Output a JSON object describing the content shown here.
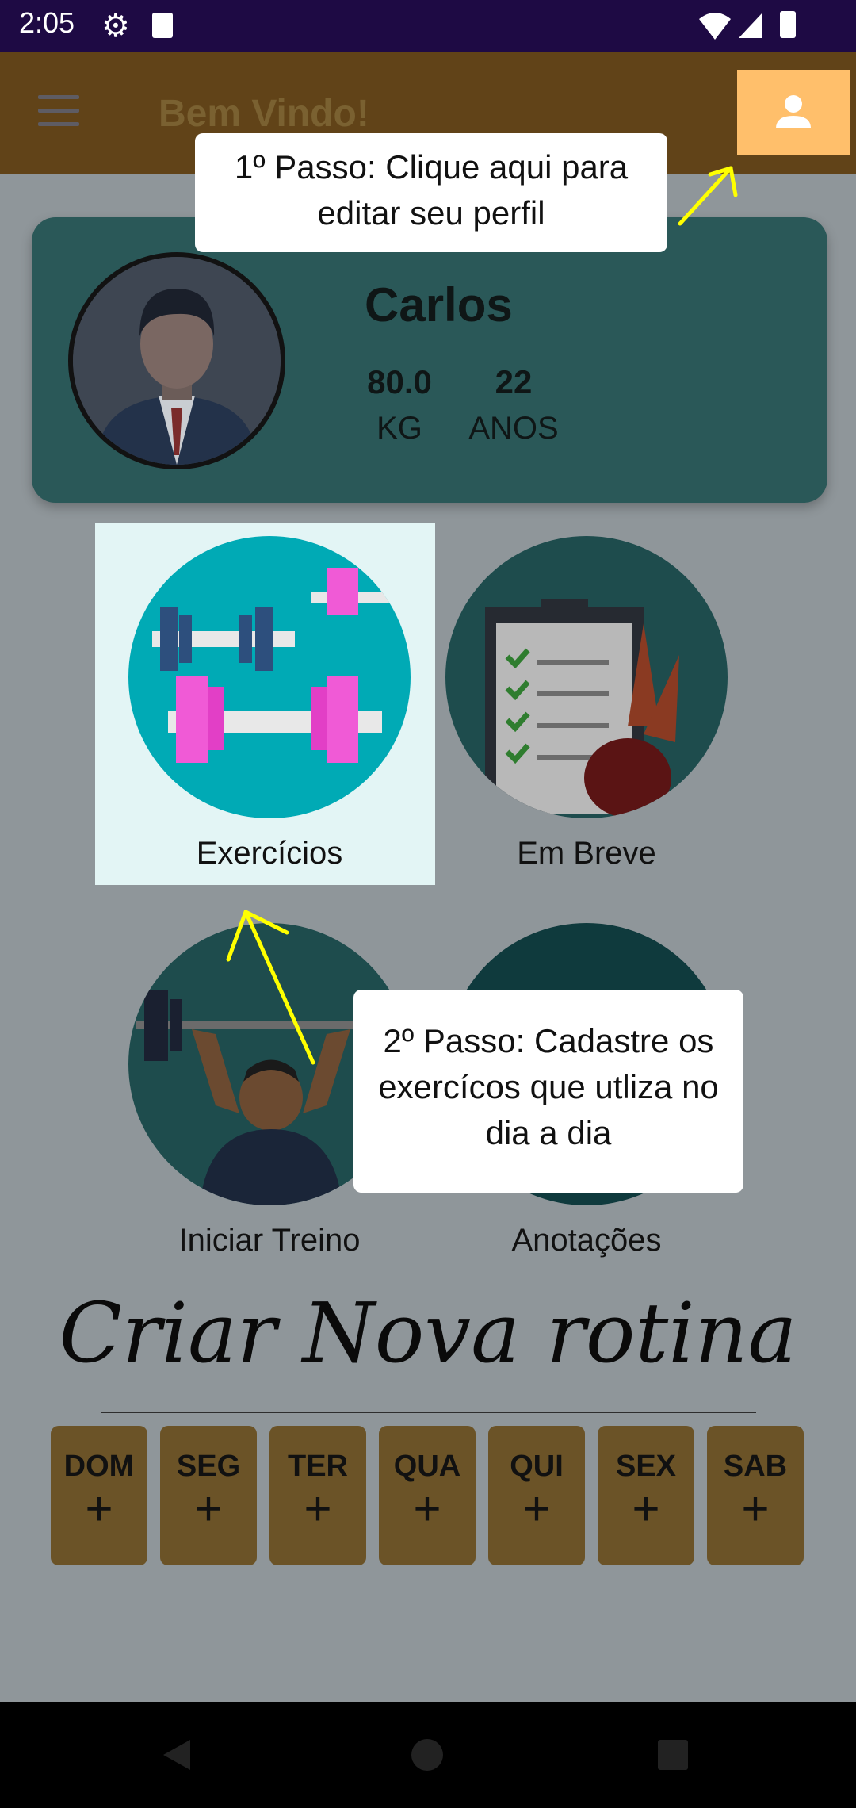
{
  "status_bar": {
    "time": "2:05"
  },
  "app_bar": {
    "title": "Bem Vindo!"
  },
  "profile": {
    "name": "Carlos",
    "weight_value": "80.0",
    "weight_unit": "KG",
    "age_value": "22",
    "age_unit": "ANOS"
  },
  "tiles": [
    {
      "label": "Exercícios"
    },
    {
      "label": "Em Breve"
    },
    {
      "label": "Iniciar Treino"
    },
    {
      "label": "Anotações"
    }
  ],
  "tooltips": {
    "step1": "1º Passo: Clique aqui para editar seu perfil",
    "step2": "2º Passo: Cadastre os exercícos que utliza no dia a dia"
  },
  "routine": {
    "title": "Criar Nova rotina",
    "days": [
      "DOM",
      "SEG",
      "TER",
      "QUA",
      "QUI",
      "SEX",
      "SAB"
    ],
    "add_symbol": "+"
  },
  "colors": {
    "accent": "#ffbf6b",
    "highlight_arrow": "#ffff00",
    "card": "#2a5858",
    "tile": "#00adb5"
  }
}
